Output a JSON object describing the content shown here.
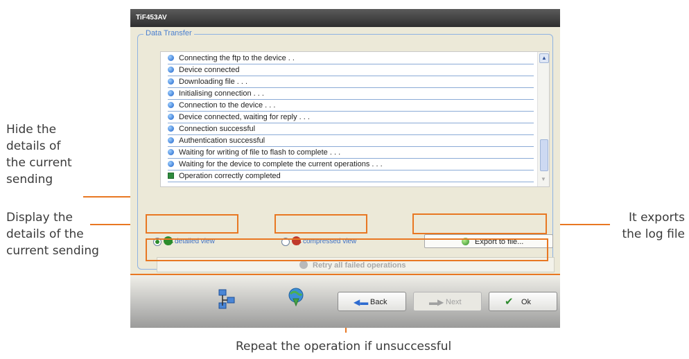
{
  "window": {
    "title": "TiF453AV"
  },
  "group": {
    "title": "Data Transfer"
  },
  "log": {
    "entries": [
      "Connecting the ftp to the device . .",
      "Device connected",
      "Downloading file . . .",
      "Initialising connection . . .",
      "Connection to the device . . .",
      "Device connected, waiting for reply . . .",
      "Connection successful",
      "Authentication successful",
      "Waiting for writing of file to flash to complete . . .",
      "Waiting for the device to complete the current operations . . .",
      "Operation correctly completed"
    ]
  },
  "view": {
    "detailed_label": "detailed view",
    "compressed_label": "compressed view",
    "selected": "detailed view"
  },
  "buttons": {
    "export": "Export to file...",
    "retry": "Retry all failed operations",
    "back": "Back",
    "next": "Next",
    "ok": "Ok"
  },
  "annotations": {
    "hide_details": [
      "Hide the",
      "details of",
      "the current",
      "sending"
    ],
    "display_details": [
      "Display the",
      "details of the",
      "current sending"
    ],
    "exports": [
      "It exports",
      "the log file"
    ],
    "repeat": "Repeat the operation if unsuccessful"
  },
  "colors": {
    "accent": "#e87722",
    "window_bg": "#ece9d8",
    "titlebar": "#3a3a3a",
    "group_border": "#8db2e3",
    "link_text": "#3f6fc2"
  },
  "icons": [
    "bullet-icon",
    "check-square-icon",
    "magnifier-icon",
    "export-icon",
    "retry-icon",
    "network-icon",
    "download-icon",
    "back-arrow-icon",
    "next-arrow-icon",
    "checkmark-icon",
    "scroll-up-icon",
    "scroll-down-icon"
  ]
}
